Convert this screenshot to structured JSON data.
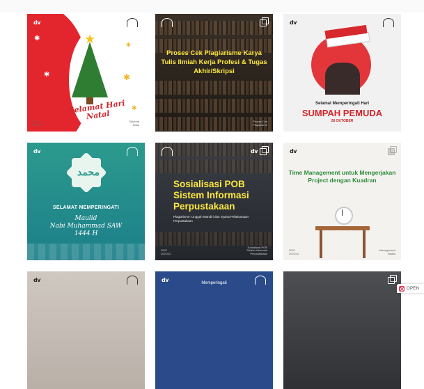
{
  "colors": {
    "brand_red": "#e3262e",
    "headline_yellow": "#ffe93f",
    "headline_green": "#2e8b3b",
    "teal": "#2c9a8d",
    "navy": "#2a4a8a"
  },
  "feed": {
    "posts": [
      {
        "logo": "dv",
        "title": "Selamat Hari Natal",
        "footer_left": "2022\n2021/22",
        "footer_right": "Selamat\nNatal"
      },
      {
        "logo": "dv",
        "title": "Proses Cek Plagiarisme Karya Tulis Ilmiah Kerja Profesi & Tugas Akhir/Skripsi",
        "footer_right": "Proses Cek\nPlagiarisme"
      },
      {
        "logo": "dv",
        "subtitle": "Selamat Memperingati Hari",
        "title": "SUMPAH PEMUDA",
        "date": "28 OKTOBER"
      },
      {
        "logo": "dv",
        "calligraphy": "محمد",
        "title": "SELAMAT MEMPERINGATI",
        "script": "Maulid\nNabi Muhammad SAW\n1444 H"
      },
      {
        "logo": "dv",
        "title": "Sosialisasi POB Sistem Informasi Perpustakaan",
        "subtitle": "Plagiarisme: Unggah Mandiri dan Syarat Pelaksanaan Perpustakaan",
        "footer_left": "2022\n2021/22",
        "footer_right": "Sosialisasi POB\nSistem Informasi\nPerpustakaan"
      },
      {
        "logo": "dv",
        "title": "Time Management untuk Mengerjakan Project dengan Kuadran",
        "footer_left": "2022\n2021/22",
        "footer_right": "Management\nWaktu"
      },
      {
        "logo": "dv"
      },
      {
        "logo": "dv",
        "title": "Memperingati"
      },
      {
        "logo": ""
      }
    ]
  },
  "open_button": {
    "label": "OPEN",
    "icon": "instagram-icon"
  }
}
